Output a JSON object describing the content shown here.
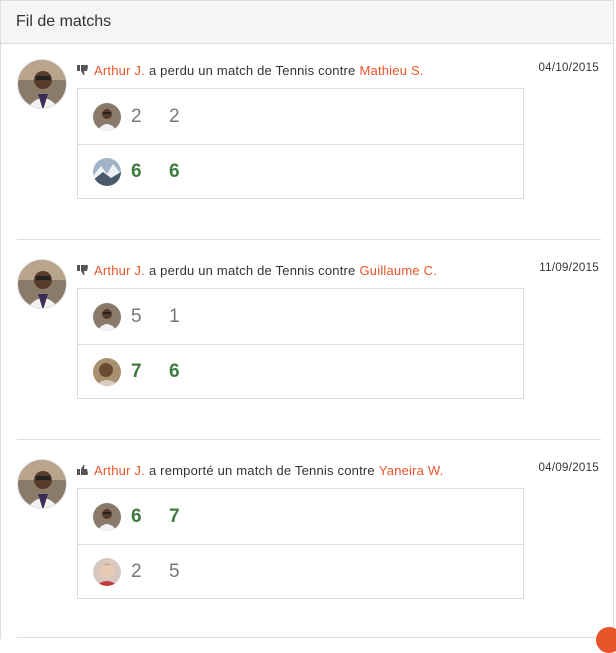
{
  "panel": {
    "title": "Fil de matchs"
  },
  "colors": {
    "accent": "#e8542a",
    "winner": "#3f7a3f",
    "loser": "#777777"
  },
  "feed": [
    {
      "icon": "thumbs-down-icon",
      "player": "Arthur J.",
      "action": "a perdu un match de Tennis contre",
      "opponent": "Mathieu S.",
      "date": "04/10/2015",
      "rows": [
        {
          "winner": false,
          "sets": [
            "2",
            "2"
          ]
        },
        {
          "winner": true,
          "sets": [
            "6",
            "6"
          ]
        }
      ]
    },
    {
      "icon": "thumbs-down-icon",
      "player": "Arthur J.",
      "action": "a perdu un match de Tennis contre",
      "opponent": "Guillaume C.",
      "date": "11/09/2015",
      "rows": [
        {
          "winner": false,
          "sets": [
            "5",
            "1"
          ]
        },
        {
          "winner": true,
          "sets": [
            "7",
            "6"
          ]
        }
      ]
    },
    {
      "icon": "thumbs-up-icon",
      "player": "Arthur J.",
      "action": "a remporté un match de Tennis contre",
      "opponent": "Yaneira W.",
      "date": "04/09/2015",
      "rows": [
        {
          "winner": true,
          "sets": [
            "6",
            "7"
          ]
        },
        {
          "winner": false,
          "sets": [
            "2",
            "5"
          ]
        }
      ]
    }
  ]
}
